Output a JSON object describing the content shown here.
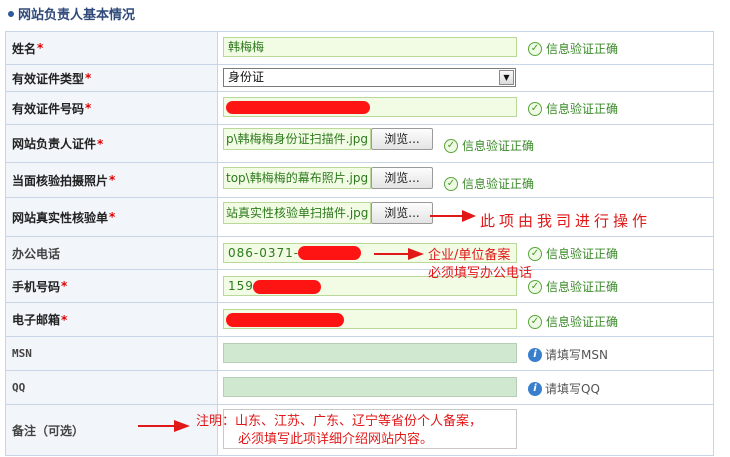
{
  "section_title": "网站负责人基本情况",
  "fields": {
    "name": {
      "label": "姓名",
      "value": "韩梅梅",
      "status": "信息验证正确"
    },
    "id_type": {
      "label": "有效证件类型",
      "selected": "身份证"
    },
    "id_number": {
      "label": "有效证件号码",
      "status": "信息验证正确"
    },
    "id_scan": {
      "label": "网站负责人证件",
      "value": "p\\韩梅梅身份证扫描件.jpg",
      "browse": "浏览...",
      "status": "信息验证正确"
    },
    "photo": {
      "label": "当面核验拍摄照片",
      "value": "top\\韩梅梅的幕布照片.jpg",
      "browse": "浏览...",
      "status": "信息验证正确"
    },
    "verify_form": {
      "label": "网站真实性核验单",
      "value": "站真实性核验单扫描件.jpg",
      "browse": "浏览..."
    },
    "office_phone": {
      "label": "办公电话",
      "value": "086-0371-5",
      "status": "信息验证正确"
    },
    "mobile": {
      "label": "手机号码",
      "value": "159",
      "status": "信息验证正确"
    },
    "email": {
      "label": "电子邮箱",
      "status": "信息验证正确"
    },
    "msn": {
      "label": "MSN",
      "hint": "请填写MSN"
    },
    "qq": {
      "label": "QQ",
      "hint": "请填写QQ"
    },
    "remarks": {
      "label": "备注（可选）"
    }
  },
  "annotations": {
    "operate": "此项由我司进行操作",
    "phone_line1": "企业/单位备案",
    "phone_line2": "必须填写办公电话",
    "remark_line1": "注明：山东、江苏、广东、辽宁等省份个人备案，",
    "remark_line2": "必须填写此项详细介绍网站内容。"
  },
  "colors": {
    "required": "#d00000",
    "valid_text": "#3b8a2a",
    "annotation": "#e01818",
    "redaction": "#ff1414"
  }
}
